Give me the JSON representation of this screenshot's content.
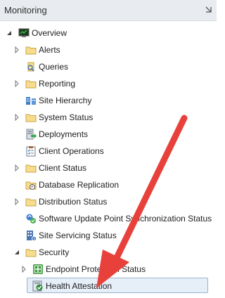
{
  "panel": {
    "title": "Monitoring"
  },
  "tree": {
    "overview": "Overview",
    "alerts": "Alerts",
    "queries": "Queries",
    "reporting": "Reporting",
    "site_hierarchy": "Site Hierarchy",
    "system_status": "System Status",
    "deployments": "Deployments",
    "client_operations": "Client Operations",
    "client_status": "Client Status",
    "database_replication": "Database Replication",
    "distribution_status": "Distribution Status",
    "software_update_point_sync_status": "Software Update Point Synchronization Status",
    "site_servicing_status": "Site Servicing Status",
    "security": "Security",
    "endpoint_protection_status": "Endpoint Protection Status",
    "health_attestation": "Health Attestation"
  },
  "selected_item": "Health Attestation",
  "colors": {
    "arrow": "#e8413c",
    "folder": "#f2d37a",
    "selection": "#e6eef8"
  }
}
